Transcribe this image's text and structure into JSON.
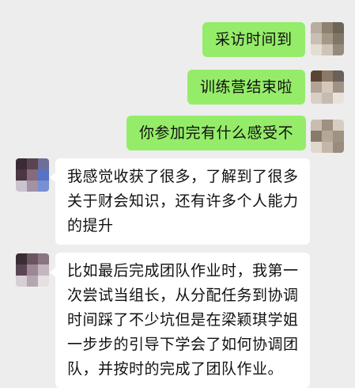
{
  "messages": [
    {
      "sender": "me",
      "text": "采访时间到"
    },
    {
      "sender": "me",
      "text": "训练营结束啦"
    },
    {
      "sender": "me",
      "text": "你参加完有什么感受不"
    },
    {
      "sender": "other",
      "lines": [
        "我感觉收获了很多，了解到了很多",
        "关于财会知识，还有许多个人能力",
        "的提升"
      ]
    },
    {
      "sender": "other",
      "lines": [
        "比如最后完成团队作业时，我第一",
        "次尝试当组长，从分配任务到协调",
        "时间踩了不少坑但是在梁颖琪学姐",
        "一步步的引导下学会了如何协调团",
        "队，并按时的完成了团队作业。"
      ]
    }
  ],
  "colors": {
    "background": "#ededed",
    "outgoing_bubble": "#95ec69",
    "incoming_bubble": "#ffffff",
    "text": "#111111"
  }
}
